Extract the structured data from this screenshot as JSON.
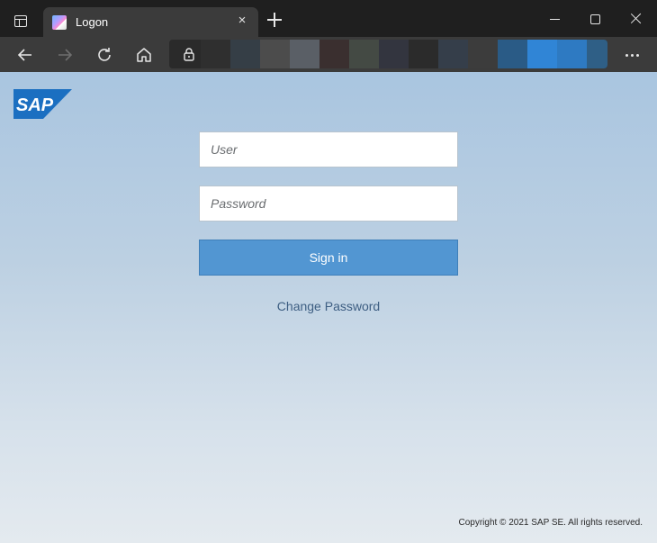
{
  "browser": {
    "tab_title": "Logon",
    "tab_close_icon": "×",
    "url_colors": [
      "#2f2f2f",
      "#353e46",
      "#4c4c4c",
      "#5a5f66",
      "#3a2f2f",
      "#444a44",
      "#33353f",
      "#2b2b2b",
      "#353e4a",
      "#3c3c3c",
      "#2a5b86",
      "#3085d6",
      "#2e7ac2",
      "#2f5f86"
    ]
  },
  "logo": {
    "text": "SAP",
    "color": "#1b6fc1"
  },
  "form": {
    "user_placeholder": "User",
    "password_placeholder": "Password",
    "signin_label": "Sign in",
    "change_password_label": "Change Password"
  },
  "footer": {
    "copyright": "Copyright © 2021 SAP SE. All rights reserved."
  },
  "colors": {
    "accent": "#5296d2",
    "link": "#3d5e82"
  }
}
